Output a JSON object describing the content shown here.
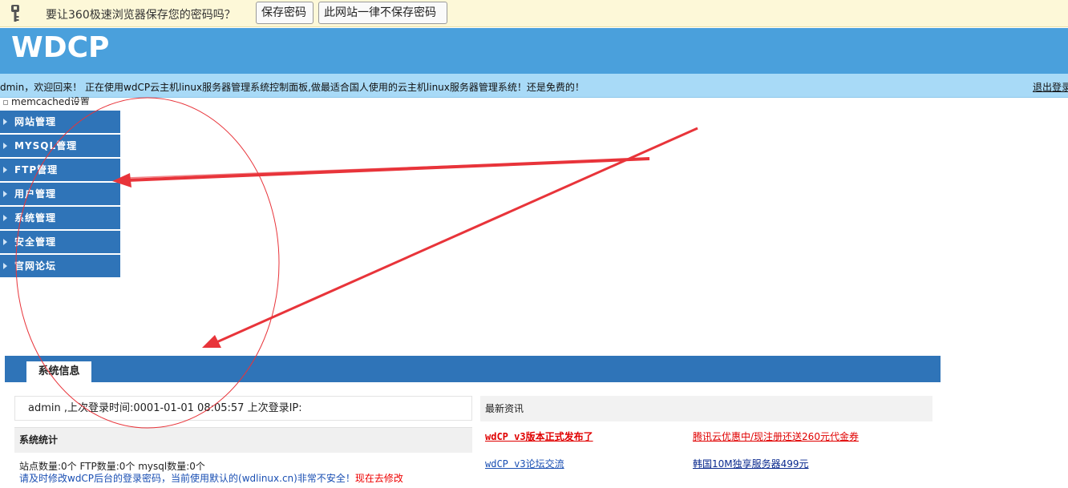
{
  "password_bar": {
    "question": "要让360极速浏览器保存您的密码吗？",
    "save_label": "保存密码",
    "never_label": "此网站一律不保存密码"
  },
  "header": {
    "logo": "WDCP"
  },
  "welcome": {
    "text": "dmin，欢迎回来！ 正在使用wdCP云主机linux服务器管理系统控制面板,做最适合国人使用的云主机linux服务器管理系统！还是免费的！",
    "logout": "退出登录"
  },
  "memcached": "memcached设置",
  "sidebar": {
    "items": [
      {
        "label": "网站管理"
      },
      {
        "label": "MYSQL管理"
      },
      {
        "label": "FTP管理"
      },
      {
        "label": "用户管理"
      },
      {
        "label": "系统管理"
      },
      {
        "label": "安全管理"
      },
      {
        "label": "官网论坛"
      }
    ]
  },
  "panel": {
    "tab": "系统信息",
    "login_info": "admin ,上次登录时间:0001-01-01 08:05:57 上次登录IP:",
    "stats_title": "系统统计",
    "stats_line": "站点数量:0个  FTP数量:0个  mysql数量:0个",
    "warning": "请及时修改wdCP后台的登录密码，当前使用默认的(wdlinux.cn)非常不安全！",
    "warning_link": "现在去修改"
  },
  "news": {
    "title": "最新资讯",
    "items": [
      {
        "text": "wdCP v3版本正式发布了",
        "color": "#e00000"
      },
      {
        "text": "腾讯云优惠中/现注册还送260元代金券",
        "color": "#e00000"
      },
      {
        "text": "wdCP v3论坛交流",
        "color": "#1a4fb3"
      },
      {
        "text": "韩国10M独享服务器499元",
        "color": "#0a2a8f"
      }
    ]
  },
  "colors": {
    "header_blue": "#4aa0dc",
    "nav_blue": "#2f74b8",
    "welcome_bg": "#a8daf7",
    "annotation_red": "#e8343a"
  }
}
